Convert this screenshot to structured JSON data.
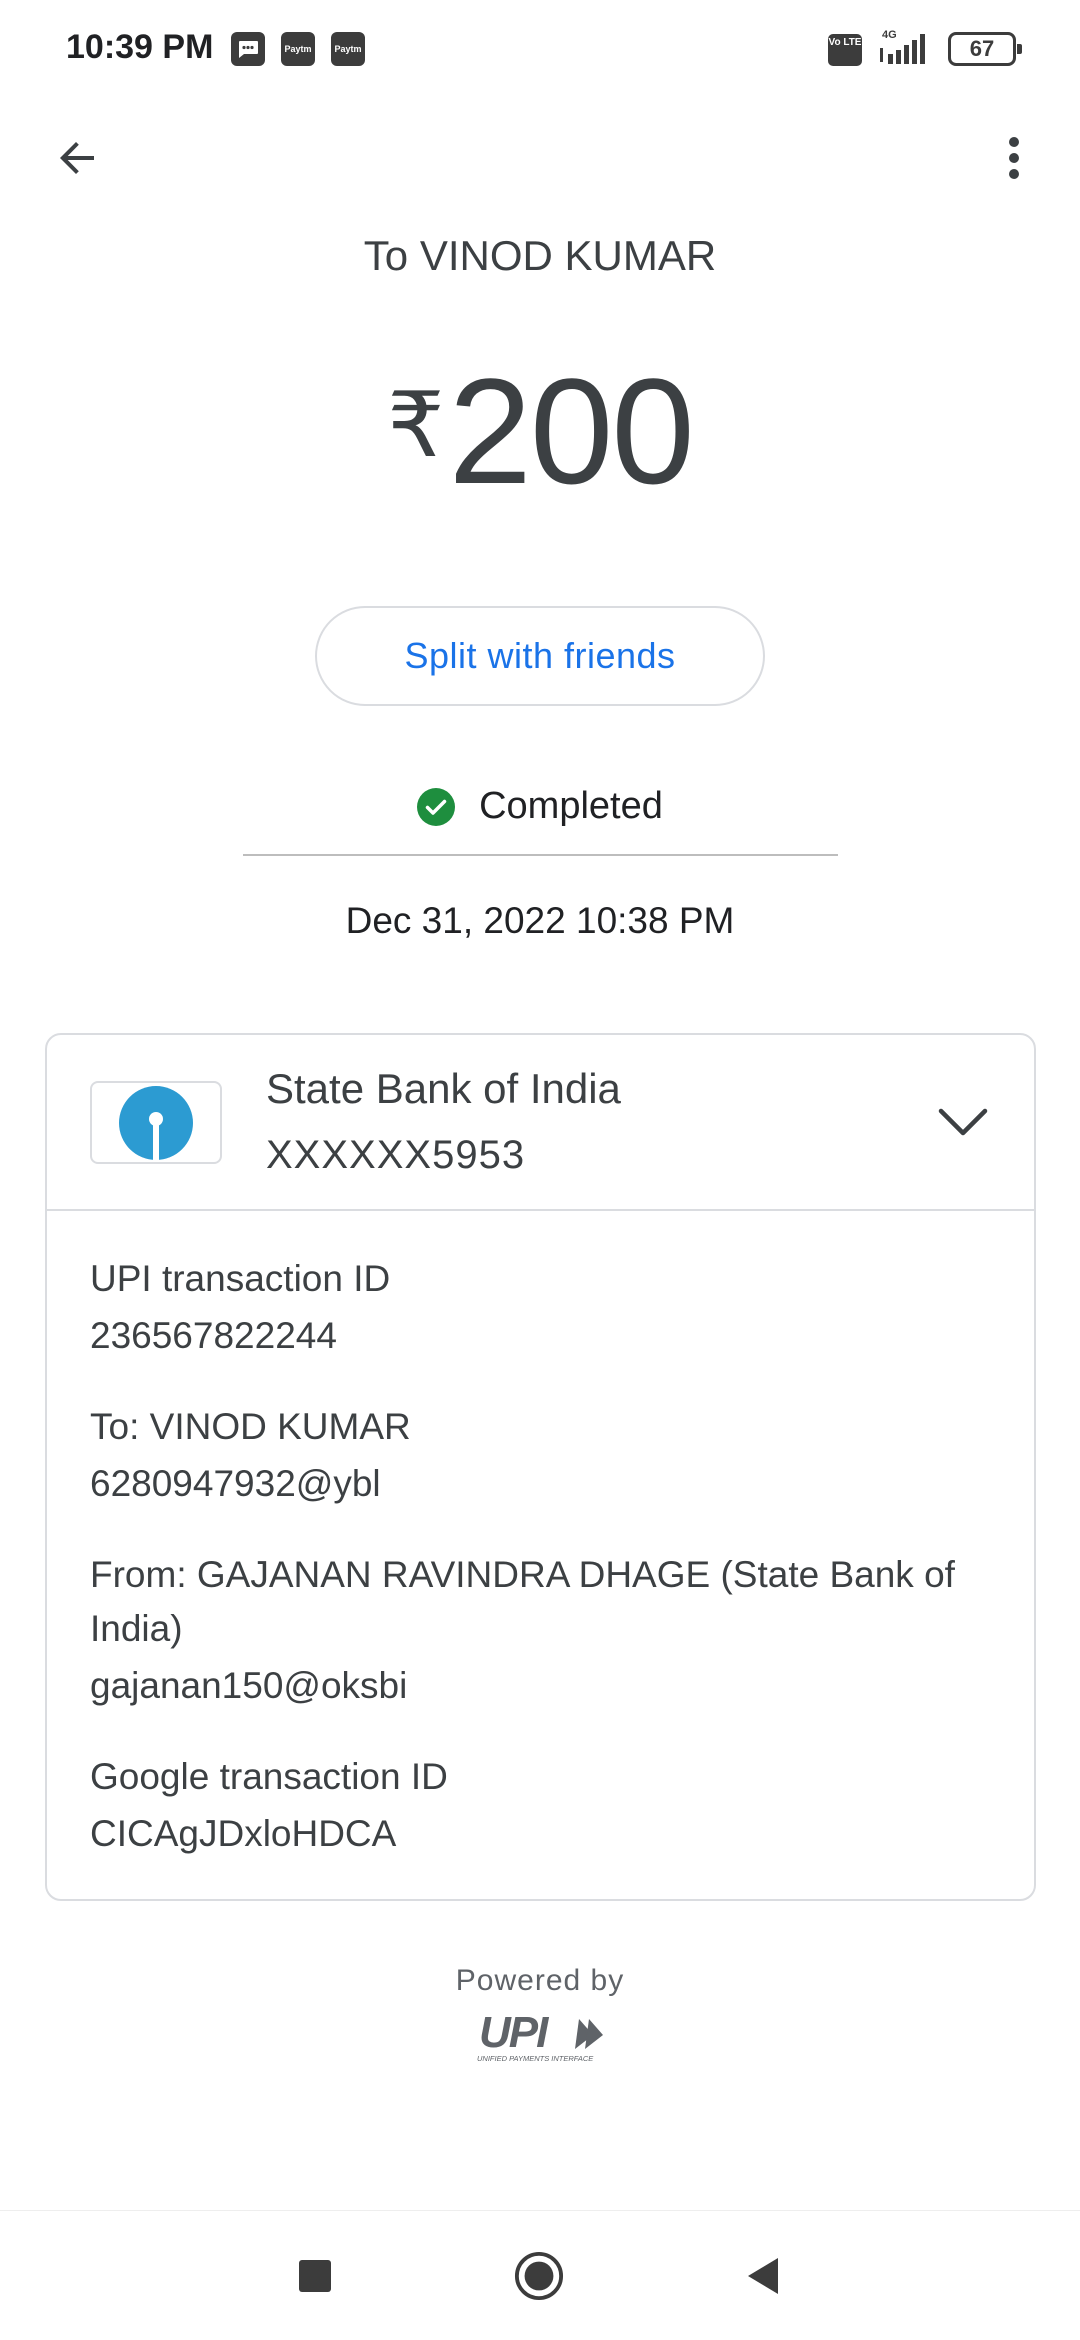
{
  "status_bar": {
    "time": "10:39 PM",
    "notification_icons": [
      "message-icon",
      "paytm-icon",
      "paytm-icon"
    ],
    "paytm_label": "Paytm",
    "volte_label": "Vo LTE",
    "network_label": "4G",
    "battery_level": "67"
  },
  "header": {
    "recipient_title": "To VINOD KUMAR"
  },
  "payment": {
    "currency_symbol": "₹",
    "amount": "200",
    "split_button_label": "Split with friends",
    "status": "Completed",
    "datetime": "Dec 31, 2022 10:38 PM"
  },
  "bank": {
    "name": "State Bank of India",
    "account": "XXXXXX5953"
  },
  "details": [
    {
      "label": "UPI transaction ID",
      "value": "236567822244"
    },
    {
      "label": "To: VINOD KUMAR",
      "value": "6280947932@ybl"
    },
    {
      "label": "From: GAJANAN RAVINDRA DHAGE (State Bank of India)",
      "value": "gajanan150@oksbi"
    },
    {
      "label": "Google transaction ID",
      "value": "CICAgJDxloHDCA"
    }
  ],
  "footer": {
    "powered_by": "Powered by",
    "upi_logo_text": "UPI",
    "upi_tagline": "UNIFIED PAYMENTS INTERFACE"
  },
  "colors": {
    "accent": "#1a73e8",
    "success": "#1e8e3e",
    "sbi_blue": "#2c9bd2",
    "text": "#3c4043"
  }
}
